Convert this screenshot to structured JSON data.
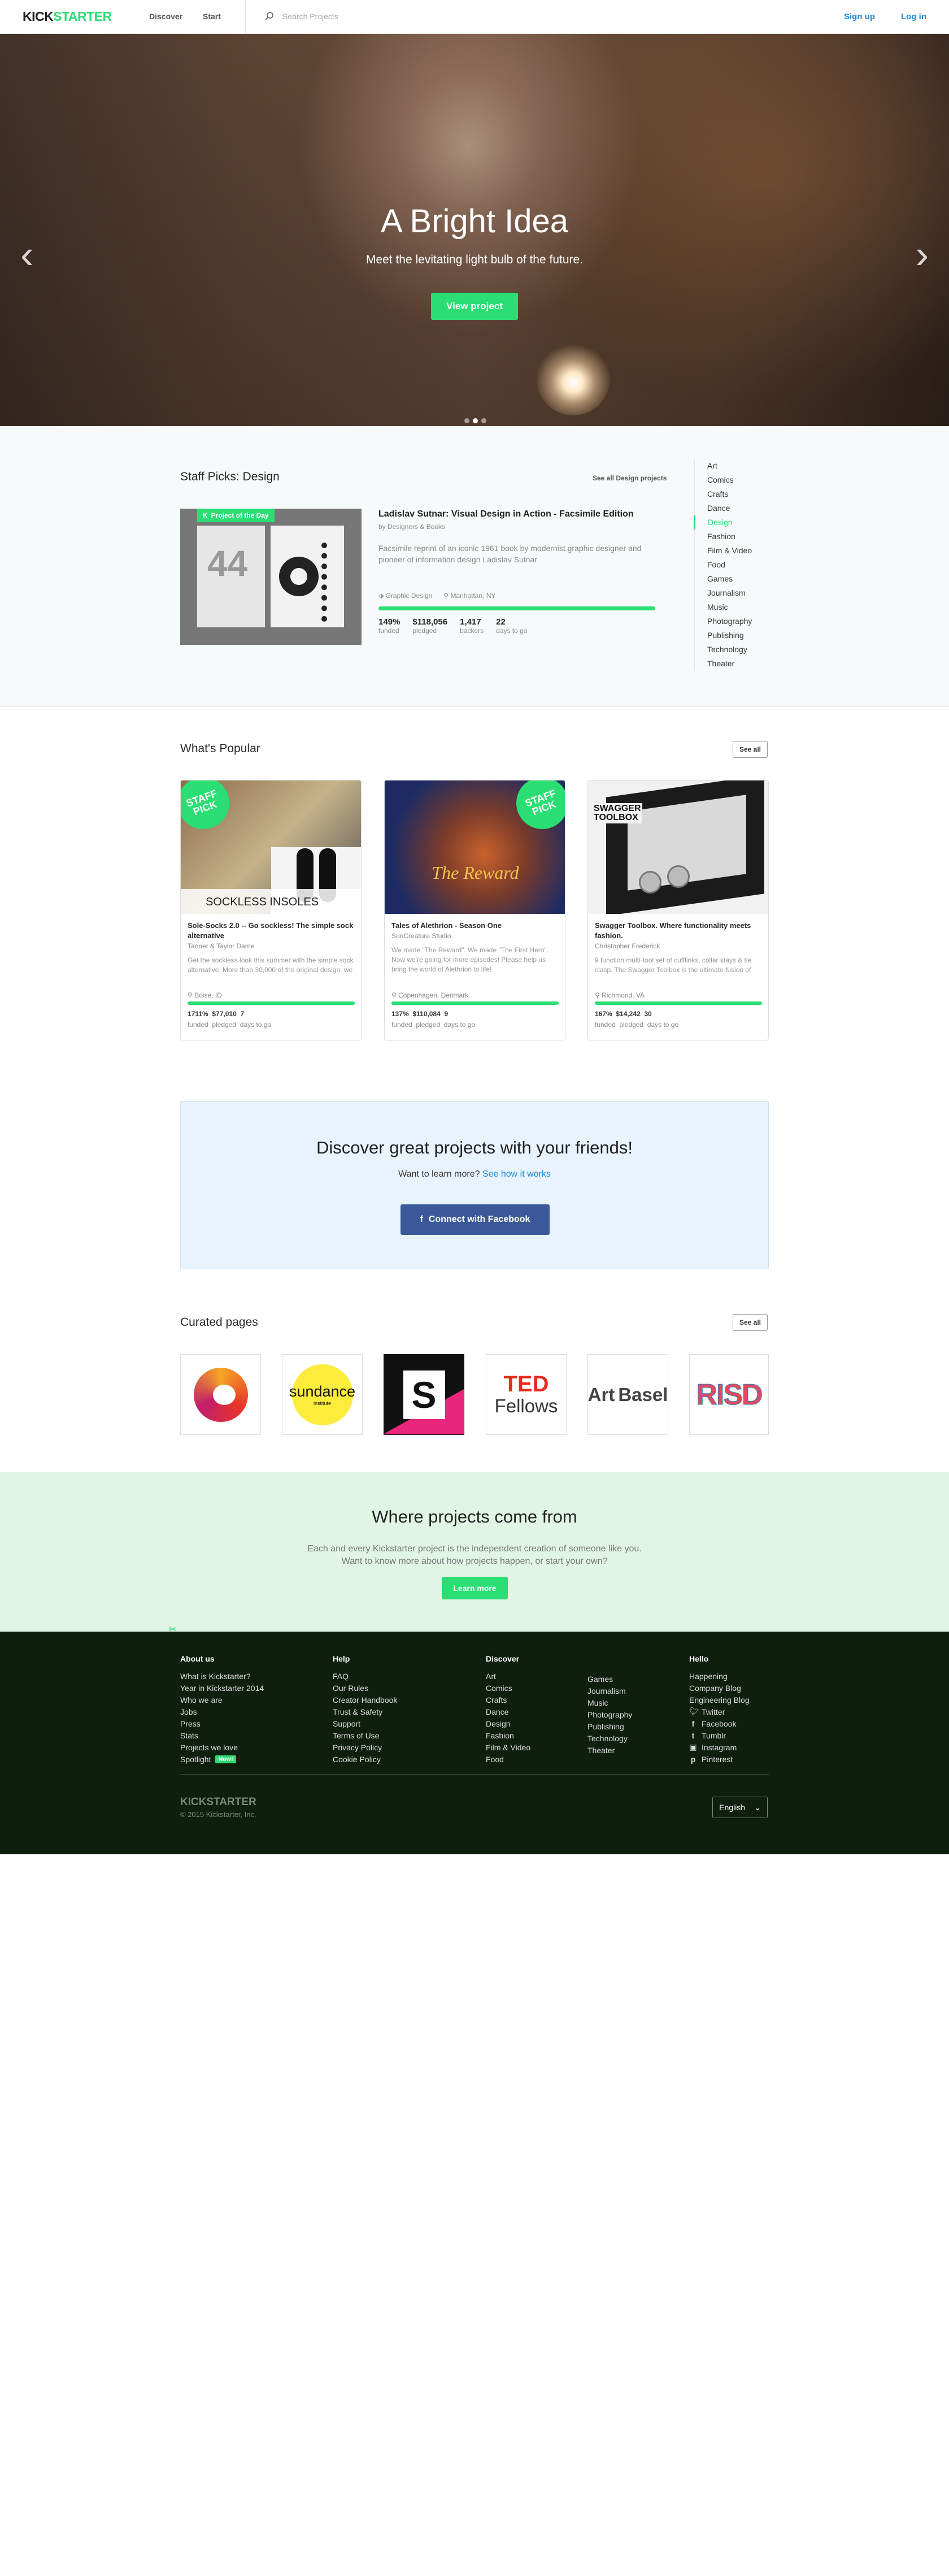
{
  "nav": {
    "logo_a": "KICK",
    "logo_b": "STARTER",
    "discover": "Discover",
    "start": "Start",
    "search_placeholder": "Search Projects",
    "signup": "Sign up",
    "login": "Log in"
  },
  "hero": {
    "title": "A Bright Idea",
    "subtitle": "Meet the levitating light bulb of the future.",
    "button": "View project"
  },
  "staff": {
    "heading": "Staff Picks: Design",
    "see_all": "See all Design projects",
    "badge": "Project of the Day",
    "project": {
      "title": "Ladislav Sutnar: Visual Design in Action - Facsimile Edition",
      "by": "by Designers & Books",
      "blurb": "Facsimile reprint of an iconic 1961 book by modernist graphic designer and pioneer of information design Ladislav Sutnar",
      "category": "Graphic Design",
      "location": "Manhattan, NY",
      "progress": 1.0,
      "stats": [
        {
          "v": "149%",
          "l": "funded"
        },
        {
          "v": "$118,056",
          "l": "pledged"
        },
        {
          "v": "1,417",
          "l": "backers"
        },
        {
          "v": "22",
          "l": "days to go"
        }
      ]
    },
    "categories": [
      "Art",
      "Comics",
      "Crafts",
      "Dance",
      "Design",
      "Fashion",
      "Film & Video",
      "Food",
      "Games",
      "Journalism",
      "Music",
      "Photography",
      "Publishing",
      "Technology",
      "Theater"
    ],
    "active_category": "Design"
  },
  "popular": {
    "heading": "What's Popular",
    "see_all": "See all",
    "badge_a": "STAFF",
    "badge_b": "PICK",
    "cards": [
      {
        "title": "Sole-Socks 2.0 -- Go sockless! The simple sock alternative",
        "by": "Tanner & Taylor Dame",
        "blurb": "Get the sockless look this summer with the simple sock alternative. More than 30,000 of the original design, we have...",
        "location": "Boise, ID",
        "funded": "1711%",
        "pledged": "$77,010",
        "days": "7",
        "image_text": "SOCKLESS INSOLES"
      },
      {
        "title": "Tales of Alethrion - Season One",
        "by": "SunCreature Studio",
        "blurb": "We made \"The Reward\". We made \"The First Hero\". Now we're going for more episodes! Please help us bring the world of Alethrion to life!",
        "location": "Copenhagen, Denmark",
        "funded": "137%",
        "pledged": "$110,084",
        "days": "9",
        "image_text": "The Reward"
      },
      {
        "title": "Swagger Toolbox. Where functionality meets fashion.",
        "by": "Christopher Frederick",
        "blurb": "9 function multi-tool set of cufflinks, collar stays & tie clasp. The Swagger Toolbox is the ultimate fusion of fashion & function.",
        "location": "Richmond, VA",
        "funded": "167%",
        "pledged": "$14,242",
        "days": "30",
        "image_text_a": "SWAGGER",
        "image_text_b": "TOOLBOX"
      }
    ],
    "labels": {
      "funded": "funded",
      "pledged": "pledged",
      "days": "days to go"
    }
  },
  "discover": {
    "title": "Discover great projects with your friends!",
    "prompt": "Want to learn more?",
    "link": "See how it works",
    "button": "Connect with Facebook"
  },
  "curated": {
    "heading": "Curated pages",
    "see_all": "See all",
    "logos": [
      "sundance",
      "institute",
      "S",
      "TED",
      "Fellows",
      "Art",
      "Basel",
      "RISD"
    ]
  },
  "where": {
    "title": "Where projects come from",
    "line1": "Each and every Kickstarter project is the independent creation of someone like you.",
    "line2": "Want to know more about how projects happen, or start your own?",
    "button": "Learn more"
  },
  "footer": {
    "about": {
      "h": "About us",
      "items": [
        "What is Kickstarter?",
        "Year in Kickstarter 2014",
        "Who we are",
        "Jobs",
        "Press",
        "Stats",
        "Projects we love",
        "Spotlight"
      ],
      "new": "New!"
    },
    "help": {
      "h": "Help",
      "items": [
        "FAQ",
        "Our Rules",
        "Creator Handbook",
        "Trust & Safety",
        "Support",
        "Terms of Use",
        "Privacy Policy",
        "Cookie Policy"
      ]
    },
    "discover": {
      "h": "Discover",
      "col1": [
        "Art",
        "Comics",
        "Crafts",
        "Dance",
        "Design",
        "Fashion",
        "Film & Video",
        "Food"
      ],
      "col2": [
        "Games",
        "Journalism",
        "Music",
        "Photography",
        "Publishing",
        "Technology",
        "Theater"
      ]
    },
    "hello": {
      "h": "Hello",
      "items": [
        "Happening",
        "Company Blog",
        "Engineering Blog",
        "Twitter",
        "Facebook",
        "Tumblr",
        "Instagram",
        "Pinterest"
      ]
    },
    "logo": "KICKSTARTER",
    "copyright": "© 2015 Kickstarter, Inc.",
    "language": "English"
  }
}
